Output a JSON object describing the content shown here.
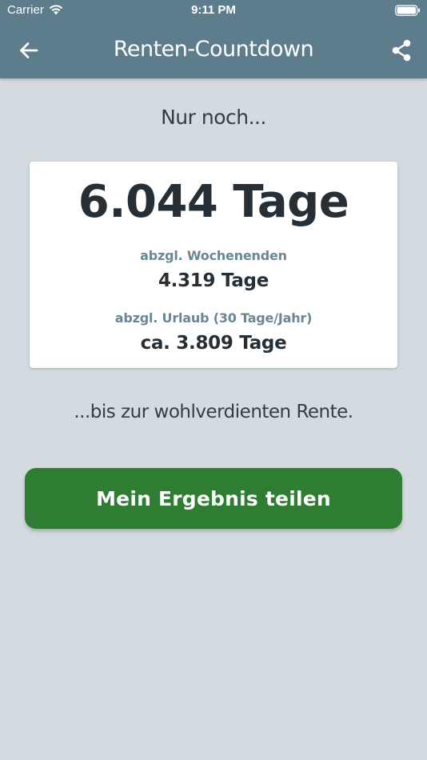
{
  "status_bar": {
    "carrier": "Carrier",
    "time": "9:11 PM",
    "icons": {
      "wifi": "wifi-icon",
      "battery": "battery-icon"
    }
  },
  "nav": {
    "title": "Renten-Countdown",
    "back_icon": "arrow-left-icon",
    "share_icon": "share-icon"
  },
  "content": {
    "intro": "Nur noch...",
    "total_days": "6.044 Tage",
    "weekends_label": "abzgl. Wochenenden",
    "weekends_value": "4.319 Tage",
    "vacation_label": "abzgl. Urlaub (30 Tage/Jahr)",
    "vacation_value": "ca. 3.809 Tage",
    "outro": "...bis zur wohlverdienten Rente.",
    "share_button": "Mein Ergebnis teilen"
  },
  "colors": {
    "header": "#5e7d8c",
    "background": "#d3dbe0",
    "card": "#ffffff",
    "accent_label": "#6b8694",
    "button": "#2e7d32",
    "text_dark": "#262f36"
  }
}
